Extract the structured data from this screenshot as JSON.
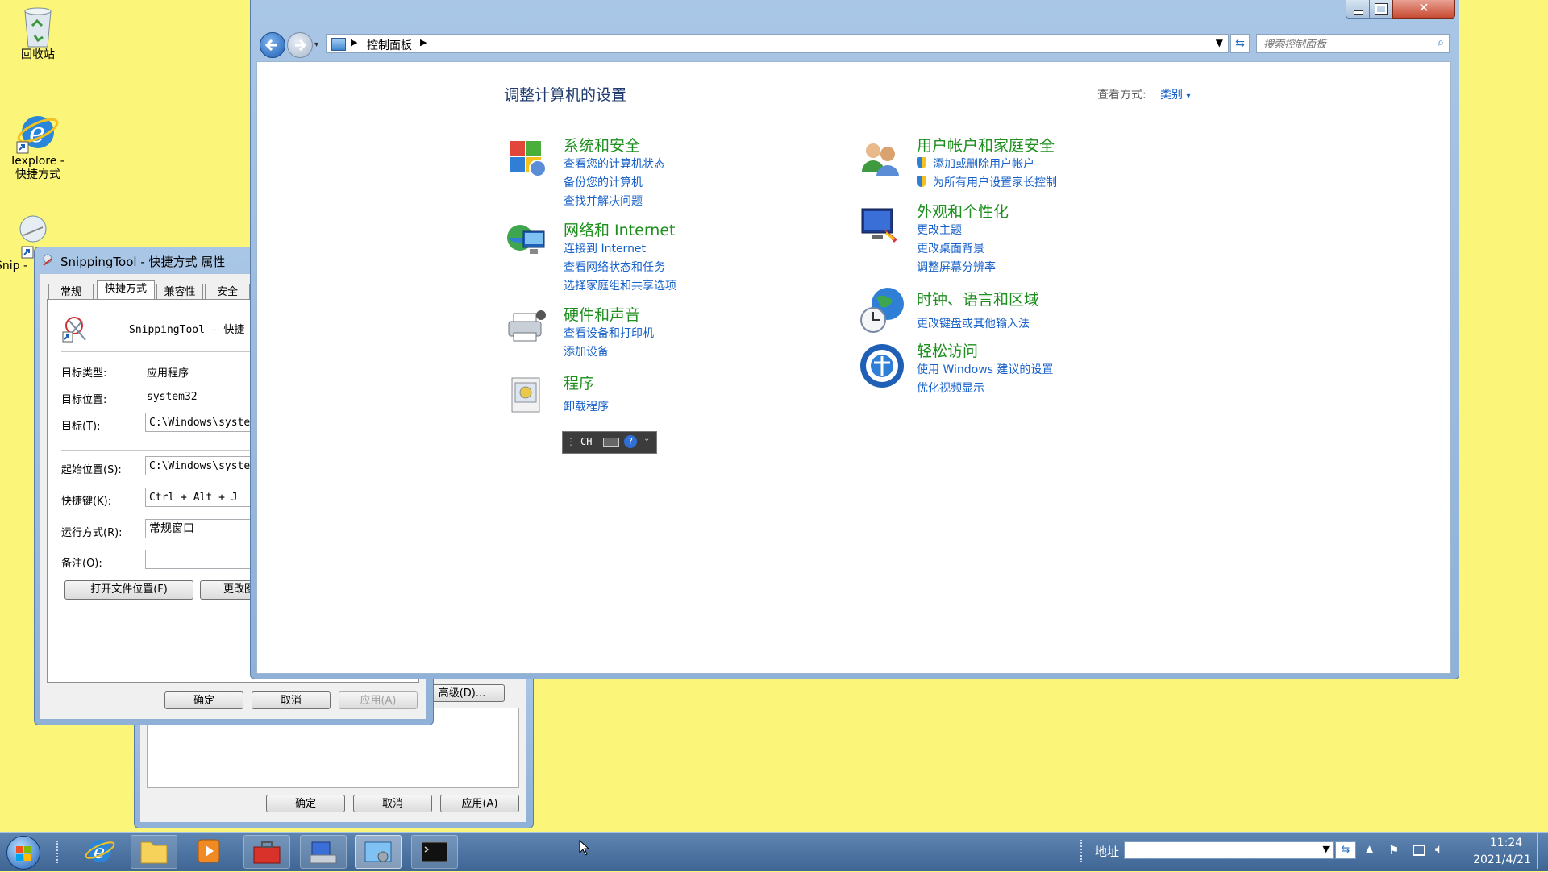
{
  "desktop": {
    "icons": [
      {
        "label": "回收站"
      },
      {
        "label": "Iexplore - 快捷方式"
      },
      {
        "label": "Snip - 快"
      }
    ]
  },
  "properties_back": {
    "advanced_btn": "高级(D)...",
    "ok": "确定",
    "cancel": "取消",
    "apply": "应用(A)"
  },
  "properties": {
    "title": "SnippingTool - 快捷方式 属性",
    "tabs": [
      "常规",
      "快捷方式",
      "兼容性",
      "安全"
    ],
    "app_name": "SnippingTool - 快捷",
    "rows": [
      {
        "label": "目标类型:",
        "value": "应用程序"
      },
      {
        "label": "目标位置:",
        "value": "system32"
      },
      {
        "label": "目标(T):",
        "value": "C:\\Windows\\syste"
      },
      {
        "label": "起始位置(S):",
        "value": "C:\\Windows\\syste"
      },
      {
        "label": "快捷键(K):",
        "value": "Ctrl + Alt + J"
      },
      {
        "label": "运行方式(R):",
        "value": "常规窗口"
      },
      {
        "label": "备注(O):",
        "value": ""
      }
    ],
    "open_location_btn": "打开文件位置(F)",
    "change_icon_btn": "更改图标",
    "ok": "确定",
    "cancel": "取消",
    "apply": "应用(A)"
  },
  "control_panel": {
    "breadcrumb": "控制面板",
    "search_placeholder": "搜索控制面板",
    "heading": "调整计算机的设置",
    "view_by_label": "查看方式:",
    "view_by_value": "类别",
    "categories_left": [
      {
        "title": "系统和安全",
        "links": [
          "查看您的计算机状态",
          "备份您的计算机",
          "查找并解决问题"
        ]
      },
      {
        "title": "网络和 Internet",
        "links": [
          "连接到 Internet",
          "查看网络状态和任务",
          "选择家庭组和共享选项"
        ]
      },
      {
        "title": "硬件和声音",
        "links": [
          "查看设备和打印机",
          "添加设备"
        ]
      },
      {
        "title": "程序",
        "links": [
          "卸载程序"
        ]
      }
    ],
    "categories_right": [
      {
        "title": "用户帐户和家庭安全",
        "links": [
          "添加或删除用户帐户",
          "为所有用户设置家长控制"
        ]
      },
      {
        "title": "外观和个性化",
        "links": [
          "更改主题",
          "更改桌面背景",
          "调整屏幕分辨率"
        ]
      },
      {
        "title": "时钟、语言和区域",
        "links": [
          "更改键盘或其他输入法"
        ]
      },
      {
        "title": "轻松访问",
        "links": [
          "使用 Windows 建议的设置",
          "优化视频显示"
        ]
      }
    ],
    "language_bar": "CH"
  },
  "taskbar": {
    "address_label": "地址",
    "time": "11:24",
    "date": "2021/4/21"
  }
}
